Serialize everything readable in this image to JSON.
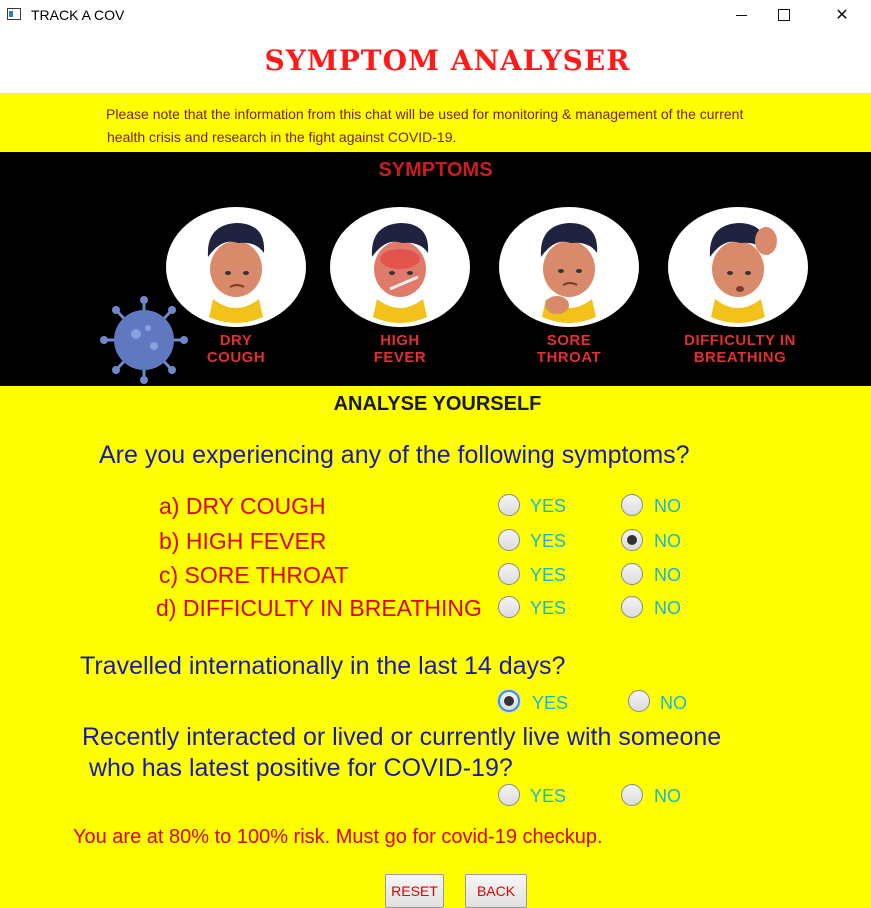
{
  "window": {
    "title": "TRACK A COV",
    "minimize_glyph": "—",
    "maximize_glyph": "☐",
    "close_glyph": "✕"
  },
  "header": {
    "app_title": "SYMPTOM ANALYSER",
    "notice_line1": "Please note that the information from this chat will be used for monitoring & management of the current",
    "notice_line2": "health crisis and research in the fight against COVID-19."
  },
  "banner": {
    "title": "SYMPTOMS",
    "symptoms": [
      {
        "line1": "DRY",
        "line2": "COUGH"
      },
      {
        "line1": "HIGH",
        "line2": "FEVER"
      },
      {
        "line1": "SORE",
        "line2": "THROAT"
      },
      {
        "line1": "DIFFICULTY IN",
        "line2": "BREATHING"
      }
    ]
  },
  "form": {
    "section_title": "ANALYSE YOURSELF",
    "q1": "Are you experiencing any of the following symptoms?",
    "symptom_rows": [
      {
        "label": "a)  DRY COUGH",
        "yes": "YES",
        "no": "NO",
        "selected": "none"
      },
      {
        "label": "b)  HIGH FEVER",
        "yes": "YES",
        "no": "NO",
        "selected": "no"
      },
      {
        "label": "c)  SORE THROAT",
        "yes": "YES",
        "no": "NO",
        "selected": "none"
      },
      {
        "label": "d)  DIFFICULTY IN BREATHING",
        "yes": "YES",
        "no": "NO",
        "selected": "none"
      }
    ],
    "q2": "Travelled internationally in the last 14 days?",
    "q2_yes": "YES",
    "q2_no": "NO",
    "q2_selected": "yes",
    "q3_line1": "Recently interacted or lived or currently live with someone",
    "q3_line2": " who has latest positive for COVID-19?",
    "q3_yes": "YES",
    "q3_no": "NO",
    "q3_selected": "none",
    "result": "You are at 80% to 100% risk. Must go for covid-19 checkup."
  },
  "buttons": {
    "reset": "RESET",
    "back": "BACK"
  },
  "colors": {
    "background": "#ffff00",
    "title": "#ff1a1a",
    "question": "#1a1aa8",
    "option": "#16b7d6",
    "result": "#e00000"
  }
}
